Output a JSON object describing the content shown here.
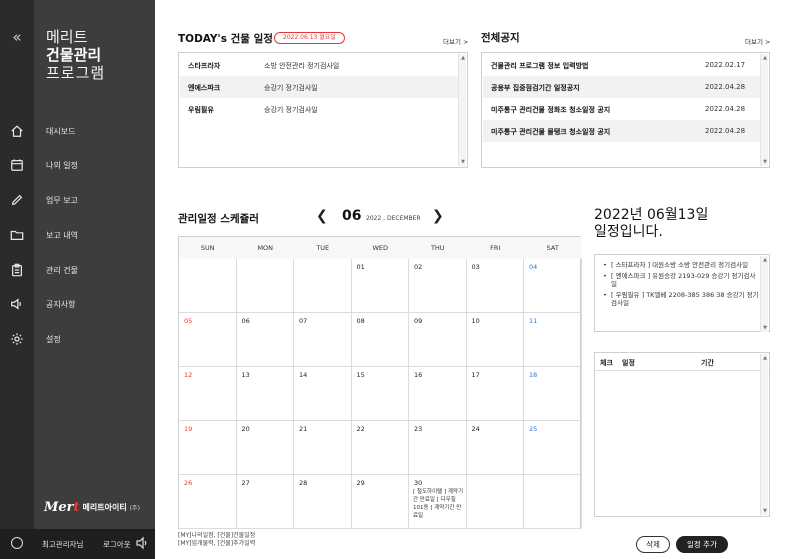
{
  "sidebar": {
    "collapse": "«",
    "brand": {
      "line1": "메리트",
      "line2": "건물관리",
      "line3": "프로그램"
    },
    "items": [
      {
        "label": "대시보드",
        "icon": "home-icon"
      },
      {
        "label": "나의 일정",
        "icon": "calendar-icon"
      },
      {
        "label": "업무 보고",
        "icon": "pencil-icon"
      },
      {
        "label": "보고 내역",
        "icon": "folder-icon"
      },
      {
        "label": "관리 건물",
        "icon": "clipboard-icon"
      },
      {
        "label": "공지사항",
        "icon": "speaker-icon"
      },
      {
        "label": "설정",
        "icon": "gear-icon"
      }
    ],
    "logo": {
      "mark_prefix": "Mer",
      "mark_suffix": "t",
      "text": "메리트아이티",
      "sub": "(주)"
    },
    "user": "최고관리자님",
    "logout": "로그아웃"
  },
  "today_panel": {
    "title": "TODAY's 건물 일정",
    "date_badge": "2022.06.13 월요일",
    "more": "더보기 >",
    "rows": [
      {
        "building": "스타프라자",
        "task": "소방 안전관리 정기검사일"
      },
      {
        "building": "엔에스파크",
        "task": "승강기 정기검사일"
      },
      {
        "building": "우림필유",
        "task": "승강기 정기검사일"
      }
    ]
  },
  "notice_panel": {
    "title": "전체공지",
    "more": "더보기 >",
    "rows": [
      {
        "title": "건물관리 프로그램 정보 입력방법",
        "date": "2022.02.17"
      },
      {
        "title": "공용부 집중점검기간 일정공지",
        "date": "2022.04.28"
      },
      {
        "title": "미주통구 관리건물 정화조 청소일정 공지",
        "date": "2022.04.28"
      },
      {
        "title": "미주통구 관리건물 물탱크 청소일정 공지",
        "date": "2022.04.28"
      }
    ]
  },
  "scheduler": {
    "title": "관리일정 스케쥴러",
    "prev": "❮",
    "next": "❯",
    "month": "06",
    "year_month": "2022 , DECEMBER",
    "dow": [
      "SUN",
      "MON",
      "TUE",
      "WED",
      "THU",
      "FRI",
      "SAT"
    ],
    "weeks": [
      [
        "",
        "",
        "",
        "01",
        "02",
        "03",
        "04"
      ],
      [
        "05",
        "06",
        "07",
        "08",
        "09",
        "10",
        "11"
      ],
      [
        "12",
        "13",
        "14",
        "15",
        "16",
        "17",
        "18"
      ],
      [
        "19",
        "20",
        "21",
        "22",
        "23",
        "24",
        "25"
      ],
      [
        "26",
        "27",
        "28",
        "29",
        "30",
        "",
        ""
      ]
    ],
    "event_30": "[ 철도하이텔 ] 계약기간 만료일 [ 다우힐101동 ] 계약기간 만료일",
    "legend1": "[MY]나의일정, [건물]건물일정",
    "legend2": "[MY]업개물력, [건물]추가일력"
  },
  "day_panel": {
    "line1": "2022년 06월13일",
    "line2": "일정입니다.",
    "items": [
      "[ 스타프라자 ] 대원소방 소방 안전관리 정기검사일",
      "[ 엔에스파크 ] 유원승강 2193-029 승강기 정기검사일",
      "[ 우림필유 ] TK엘베 2208-385 386 38 승강기 정기검사일"
    ],
    "check_header": {
      "check": "체크",
      "schedule": "일정",
      "period": "기간"
    },
    "delete_btn": "삭제",
    "add_btn": "일정 추가"
  }
}
